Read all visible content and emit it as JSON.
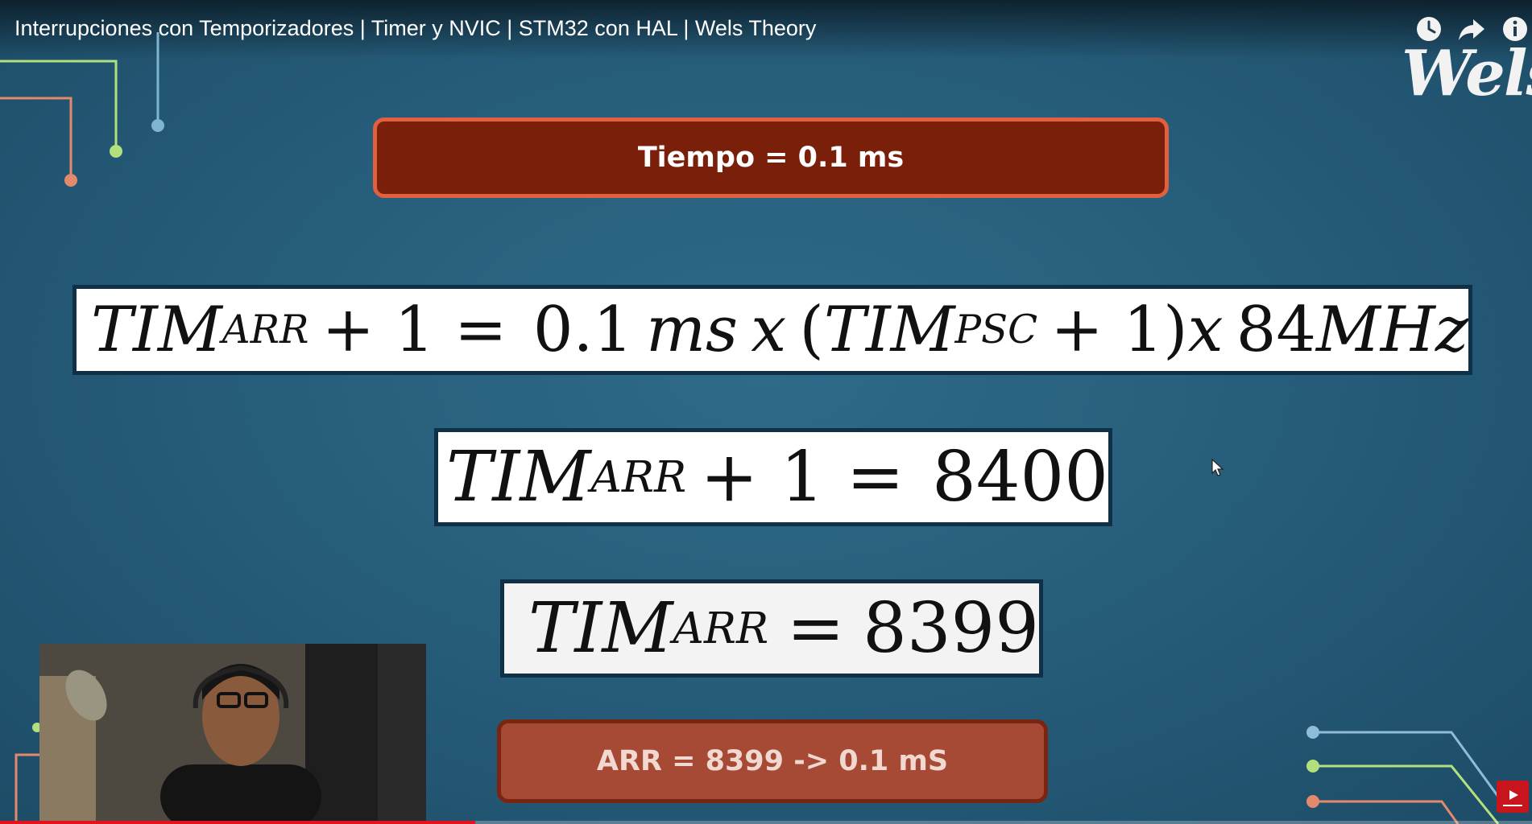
{
  "video": {
    "title": "Interrupciones con Temporizadores | Timer y NVIC | STM32 con HAL | Wels Theory",
    "progress": 0.31
  },
  "top_controls": [
    {
      "name": "watch-later",
      "icon": "clock-icon"
    },
    {
      "name": "share",
      "icon": "share-icon"
    },
    {
      "name": "info",
      "icon": "info-icon"
    }
  ],
  "brand": {
    "logo_text": "Wels"
  },
  "slide": {
    "title_box": "Tiempo = 0.1 ms",
    "formula1": {
      "lhs": "TIM",
      "lhs_sub": "ARR",
      "plus_one": "+ 1 =",
      "value": "0.1",
      "unit": "ms",
      "times1": "x",
      "paren_open": "(",
      "psc": "TIM",
      "psc_sub": "PSC",
      "psc_plus": "+ 1)",
      "times2": "x",
      "freq": "84",
      "freq_unit": "MHz"
    },
    "formula2": {
      "lhs": "TIM",
      "lhs_sub": "ARR",
      "rest": "+ 1 =",
      "value": "8400"
    },
    "formula3": {
      "lhs": "TIM",
      "lhs_sub": "ARR",
      "eq": "=",
      "value": "8399"
    },
    "result_box": "ARR = 8399 -> 0.1 mS"
  },
  "colors": {
    "background": "#255b78",
    "title_box": "#7a1f0a",
    "title_border": "#e0603f",
    "result_box": "#a64a35",
    "progress": "#e5121d"
  }
}
